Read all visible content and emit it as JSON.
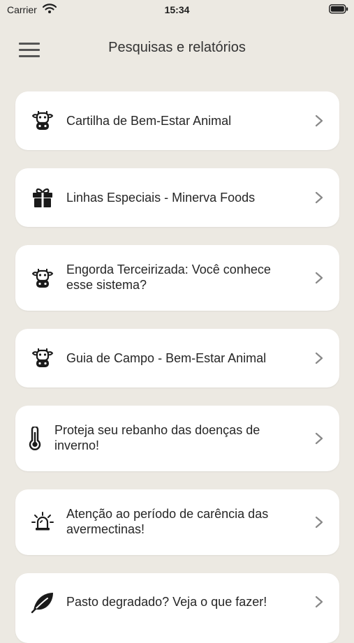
{
  "status_bar": {
    "carrier": "Carrier",
    "time": "15:34"
  },
  "header": {
    "title": "Pesquisas e relatórios"
  },
  "items": [
    {
      "label": "Cartilha de Bem-Estar Animal",
      "icon": "cow-icon"
    },
    {
      "label": "Linhas Especiais - Minerva Foods",
      "icon": "gift-icon"
    },
    {
      "label": "Engorda Terceirizada: Você conhece esse sistema?",
      "icon": "cow-icon"
    },
    {
      "label": "Guia de Campo - Bem-Estar Animal",
      "icon": "cow-icon"
    },
    {
      "label": "Proteja seu rebanho das doenças de inverno!",
      "icon": "thermometer-icon"
    },
    {
      "label": "Atenção ao período de carência das avermectinas!",
      "icon": "alarm-icon"
    },
    {
      "label": "Pasto degradado? Veja o que fazer!",
      "icon": "leaf-icon"
    }
  ]
}
